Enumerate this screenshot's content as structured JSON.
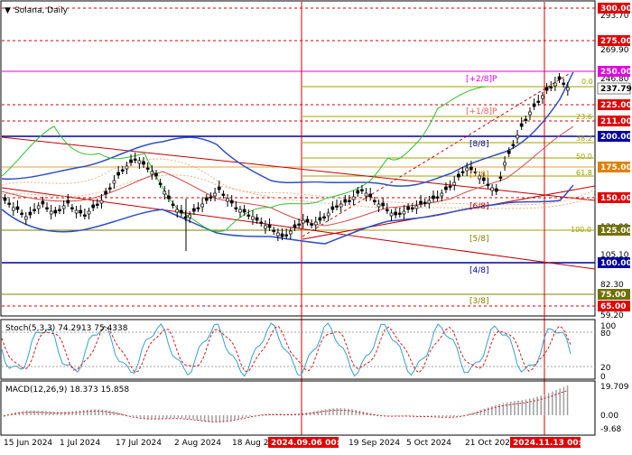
{
  "title": "Solana, Daily",
  "colors": {
    "price_text": "#000000",
    "badge_red": "#e00000",
    "badge_blue": "#0000a0",
    "badge_orange": "#e08000",
    "badge_green": "#707000",
    "badge_magenta": "#e000e0",
    "current_price": "#ffffff",
    "bollinger": "#3050c0",
    "ichimoku_green": "#30c030",
    "candles": "#000000",
    "red_lines": "#c00000"
  },
  "price_axis": {
    "labels": [
      "300.00",
      "293.70",
      "275.00",
      "269.90",
      "250.00",
      "246.80",
      "237.79",
      "225.00",
      "211.00",
      "200.00",
      "175.00",
      "150.00",
      "130.00",
      "125.00",
      "105.10",
      "100.00",
      "82.30",
      "75.00",
      "65.00",
      "59.20"
    ],
    "badges": [
      {
        "text": "300.00",
        "color": "#e00000"
      },
      {
        "text": "275.00",
        "color": "#e00000"
      },
      {
        "text": "250.00",
        "color": "#e000e0"
      },
      {
        "text": "237.79",
        "color": "#ffffff"
      },
      {
        "text": "225.00",
        "color": "#e00000"
      },
      {
        "text": "211.00",
        "color": "#e00000"
      },
      {
        "text": "200.00",
        "color": "#0000a0"
      },
      {
        "text": "175.00",
        "color": "#e08000"
      },
      {
        "text": "150.00",
        "color": "#e00000"
      },
      {
        "text": "125.00",
        "color": "#707000"
      },
      {
        "text": "100.00",
        "color": "#0000a0"
      },
      {
        "text": "75.00",
        "color": "#707000"
      },
      {
        "text": "65.00",
        "color": "#e00000"
      }
    ],
    "plain": [
      "293.70",
      "269.90",
      "246.80",
      "130.00",
      "105.10",
      "82.30",
      "59.20"
    ]
  },
  "murrey_labels": [
    "[+2/8]P",
    "[+1/8]P",
    "[8/8]",
    "[7/8]",
    "[6/8]",
    "[5/8]",
    "[4/8]",
    "[3/8]"
  ],
  "fib_labels": [
    "0.0",
    "23.6",
    "38.2",
    "50.0",
    "61.8",
    "100.0"
  ],
  "stoch": {
    "title": "Stoch(5,3,3) 74.2913 75.4338",
    "axis": [
      "100",
      "80",
      "20",
      "0"
    ]
  },
  "macd": {
    "title": "MACD(12,26,9) 18.373 15.858",
    "axis": [
      "19.709",
      "0.00",
      "-9.68"
    ]
  },
  "x_axis": {
    "labels": [
      "15 Jun 2024",
      "1 Jul 2024",
      "17 Jul 2024",
      "2 Aug 2024",
      "18 Aug 2",
      "19 Sep 2024",
      "5 Oct 2024",
      "21 Oct 202"
    ],
    "highlight": [
      "2024.09.06 00:00",
      "2024.11.13 00:00"
    ]
  }
}
